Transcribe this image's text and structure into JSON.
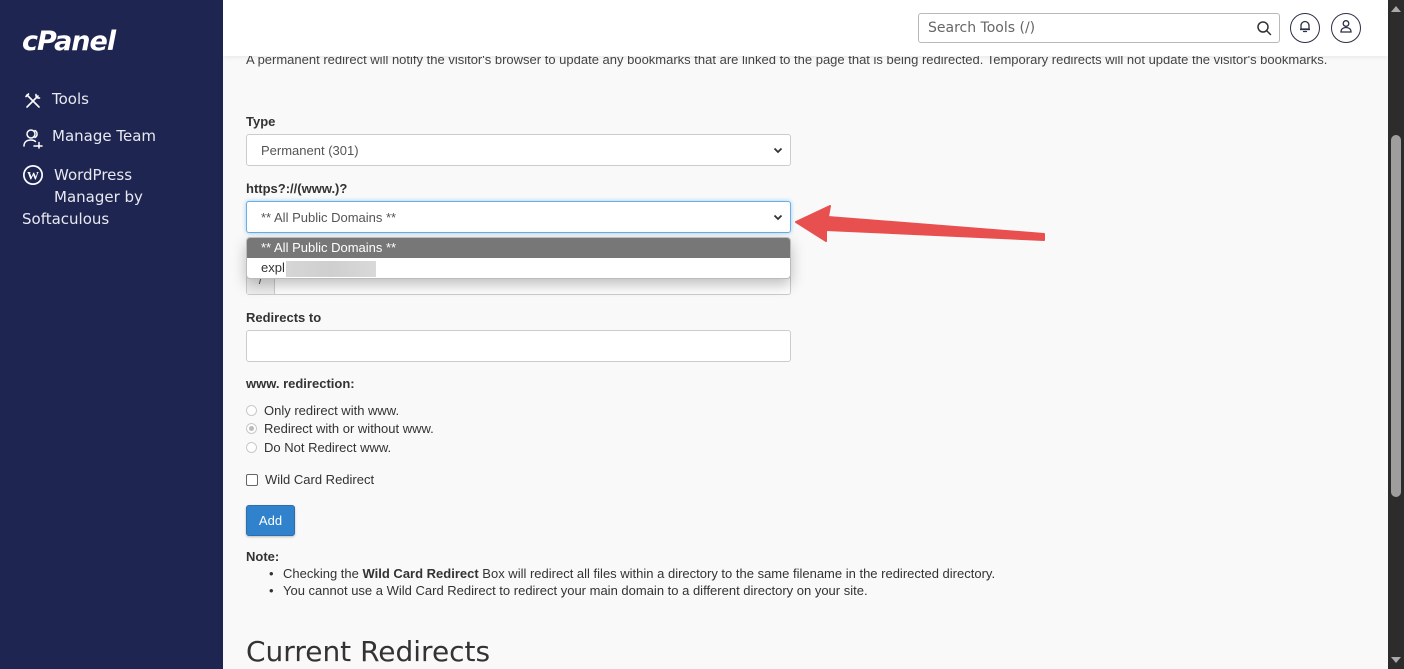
{
  "sidebar": {
    "logo": "cPanel",
    "items": [
      {
        "label": "Tools",
        "icon": "tools-icon"
      },
      {
        "label": "Manage Team",
        "icon": "manage-team-icon"
      },
      {
        "label_lines": [
          "WordPress",
          "Manager by",
          "Softaculous"
        ],
        "icon": "wordpress-icon"
      }
    ]
  },
  "header": {
    "search_placeholder": "Search Tools (/)",
    "bell_icon": "bell-icon",
    "user_icon": "user-icon"
  },
  "main": {
    "intro": "A permanent redirect will notify the visitor's browser to update any bookmarks that are linked to the page that is being redirected. Temporary redirects will not update the visitor's bookmarks.",
    "type_label": "Type",
    "type_value": "Permanent (301)",
    "domain_label": "https?://(www.)?",
    "domain_value": "** All Public Domains **",
    "domain_options": [
      "** All Public Domains **",
      "expl"
    ],
    "path_prefix": "/",
    "path_value": "",
    "redirects_to_label": "Redirects to",
    "redirects_to_value": "",
    "www_label": "www. redirection:",
    "www_options": [
      {
        "label": "Only redirect with www.",
        "checked": false
      },
      {
        "label": "Redirect with or without www.",
        "checked": true
      },
      {
        "label": "Do Not Redirect www.",
        "checked": false
      }
    ],
    "wildcard_label": "Wild Card Redirect",
    "wildcard_checked": false,
    "add_label": "Add",
    "note_title": "Note:",
    "notes": [
      {
        "pre": "Checking the ",
        "bold": "Wild Card Redirect",
        "post": " Box will redirect all files within a directory to the same filename in the redirected directory."
      },
      {
        "pre": "You cannot use a Wild Card Redirect to redirect your main domain to a different directory on your site.",
        "bold": "",
        "post": ""
      }
    ],
    "current_redirects_title": "Current Redirects"
  },
  "colors": {
    "sidebar_bg": "#1e2551",
    "primary_button": "#3182cc",
    "annotation_arrow": "#e8504f",
    "dropdown_selected": "#777777"
  }
}
